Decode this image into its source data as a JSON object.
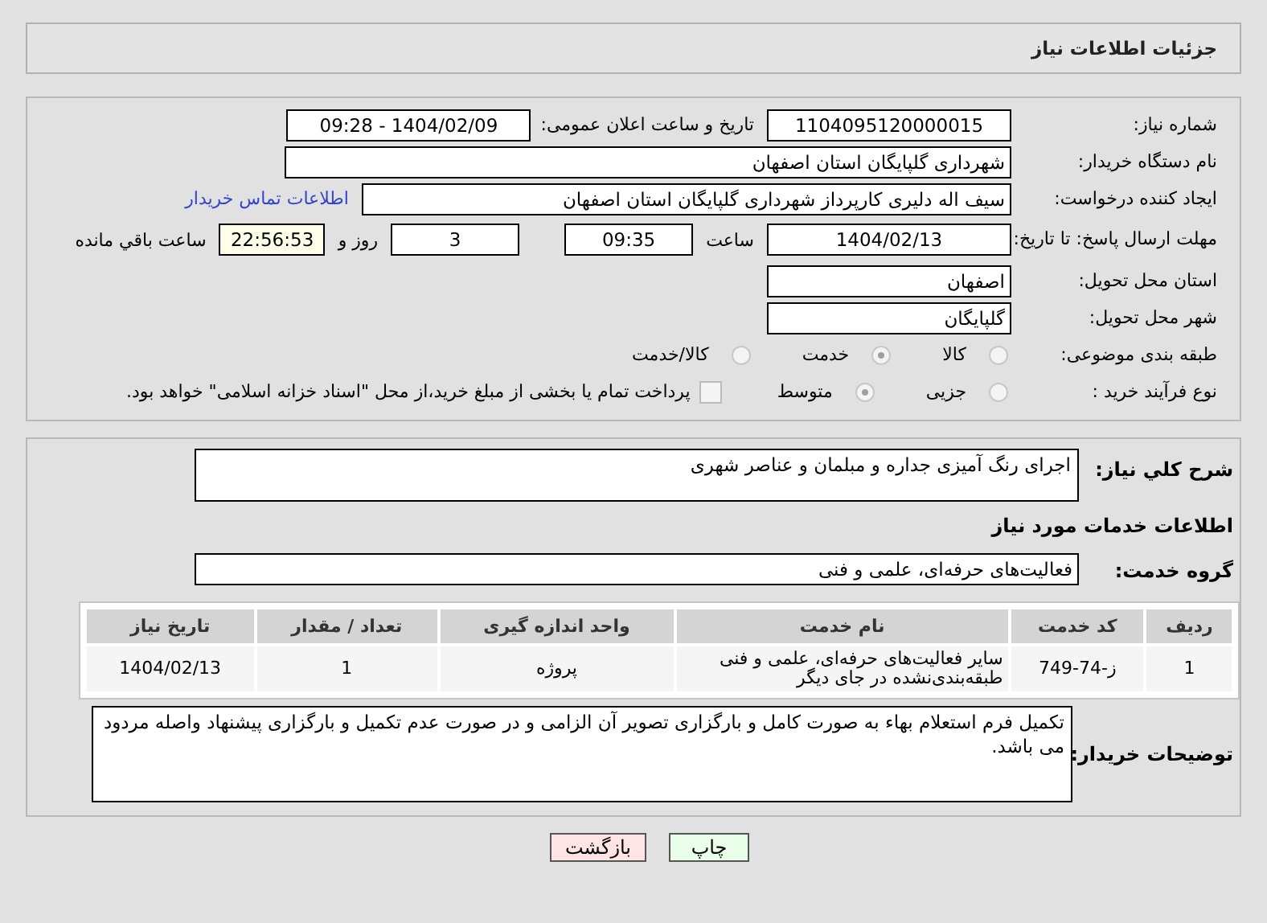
{
  "header": {
    "title": "جزئیات اطلاعات نیاز"
  },
  "need_number": {
    "label": "شماره نیاز:",
    "value": "1104095120000015"
  },
  "announce": {
    "label": "تاریخ و ساعت اعلان عمومی:",
    "value": "1404/02/09 - 09:28"
  },
  "buyer": {
    "label": "نام دستگاه خریدار:",
    "value": "شهرداری گلپایگان استان اصفهان"
  },
  "creator": {
    "label": "ایجاد کننده درخواست:",
    "value": "سیف اله دلیری کارپرداز شهرداری گلپایگان استان اصفهان",
    "link": "اطلاعات تماس خریدار"
  },
  "deadline": {
    "label": "مهلت ارسال پاسخ: تا تاریخ:",
    "date": "1404/02/13",
    "time_label": "ساعت",
    "time": "09:35",
    "days": "3",
    "days_label": "روز و",
    "remaining": "22:56:53",
    "remaining_label": "ساعت باقي مانده"
  },
  "province": {
    "label": "استان محل تحویل:",
    "value": "اصفهان"
  },
  "city": {
    "label": "شهر محل تحویل:",
    "value": "گلپایگان"
  },
  "category": {
    "label": "طبقه بندی موضوعی:",
    "options": [
      {
        "label": "کالا",
        "selected": false
      },
      {
        "label": "خدمت",
        "selected": true
      },
      {
        "label": "کالا/خدمت",
        "selected": false
      }
    ]
  },
  "process": {
    "label": "نوع فرآیند خرید :",
    "options": [
      {
        "label": "جزیی",
        "selected": false
      },
      {
        "label": "متوسط",
        "selected": true
      }
    ],
    "payment": {
      "checked": false,
      "text": "پرداخت تمام یا بخشی از مبلغ خرید،از محل \"اسناد خزانه اسلامی\" خواهد بود."
    }
  },
  "summary": {
    "label": "شرح كلي نياز:",
    "value": "اجرای رنگ آمیزی جداره و مبلمان و عناصر شهری"
  },
  "services_heading": "اطلاعات خدمات مورد نیاز",
  "service_group": {
    "label": "گروه خدمت:",
    "value": "فعالیت‌های حرفه‌ای، علمی و فنی"
  },
  "table": {
    "columns": [
      "ردیف",
      "کد خدمت",
      "نام خدمت",
      "واحد اندازه گیری",
      "تعداد / مقدار",
      "تاریخ نیاز"
    ],
    "rows": [
      [
        "1",
        "ز-74-749",
        "سایر فعالیت‌های حرفه‌ای، علمی و فنی طبقه‌بندی‌نشده در جای دیگر",
        "پروژه",
        "1",
        "1404/02/13"
      ]
    ]
  },
  "buyer_notes": {
    "label": "توضیحات خریدار:",
    "value": "تکمیل فرم استعلام بهاء به صورت کامل و بارگزاری تصویر آن الزامی و در صورت عدم تکمیل و بارگزاری پیشنهاد واصله مردود می باشد."
  },
  "buttons": [
    {
      "kind": "print",
      "label": "چاپ"
    },
    {
      "kind": "back",
      "label": "بازگشت"
    }
  ]
}
